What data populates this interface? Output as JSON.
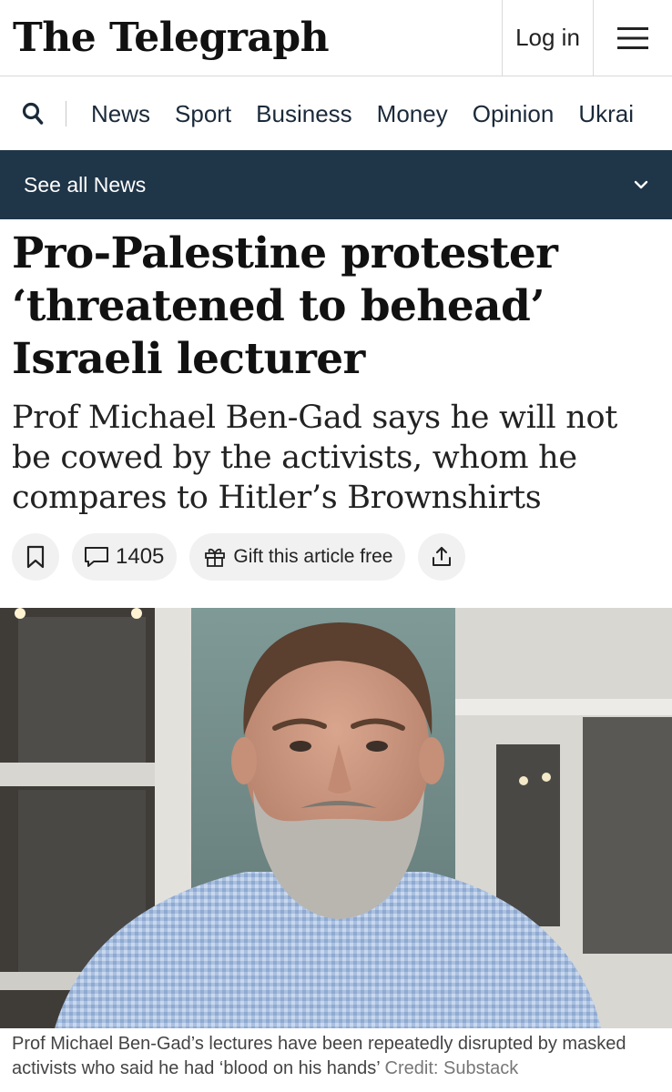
{
  "header": {
    "logo": "The Telegraph",
    "login_label": "Log in"
  },
  "nav": {
    "items": [
      "News",
      "Sport",
      "Business",
      "Money",
      "Opinion",
      "Ukrai"
    ]
  },
  "section_bar": {
    "label": "See all News"
  },
  "article": {
    "headline": "Pro-Palestine protester ‘threatened to behead’ Israeli lecturer",
    "standfirst": "Prof Michael Ben-Gad says he will not be cowed by the activists, whom he compares to Hitler’s Brownshirts",
    "comment_count": "1405",
    "gift_label": "Gift this article free",
    "caption": "Prof Michael Ben-Gad’s lectures have been repeatedly disrupted by masked activists who said he had ‘blood on his hands’",
    "credit": "Credit: Substack"
  },
  "colors": {
    "section_bar_bg": "#1f3548",
    "pill_bg": "#f1f1f1",
    "text": "#111111"
  },
  "icons": [
    "search-icon",
    "menu-icon",
    "chevron-down-icon",
    "bookmark-icon",
    "comment-icon",
    "gift-icon",
    "share-icon"
  ]
}
